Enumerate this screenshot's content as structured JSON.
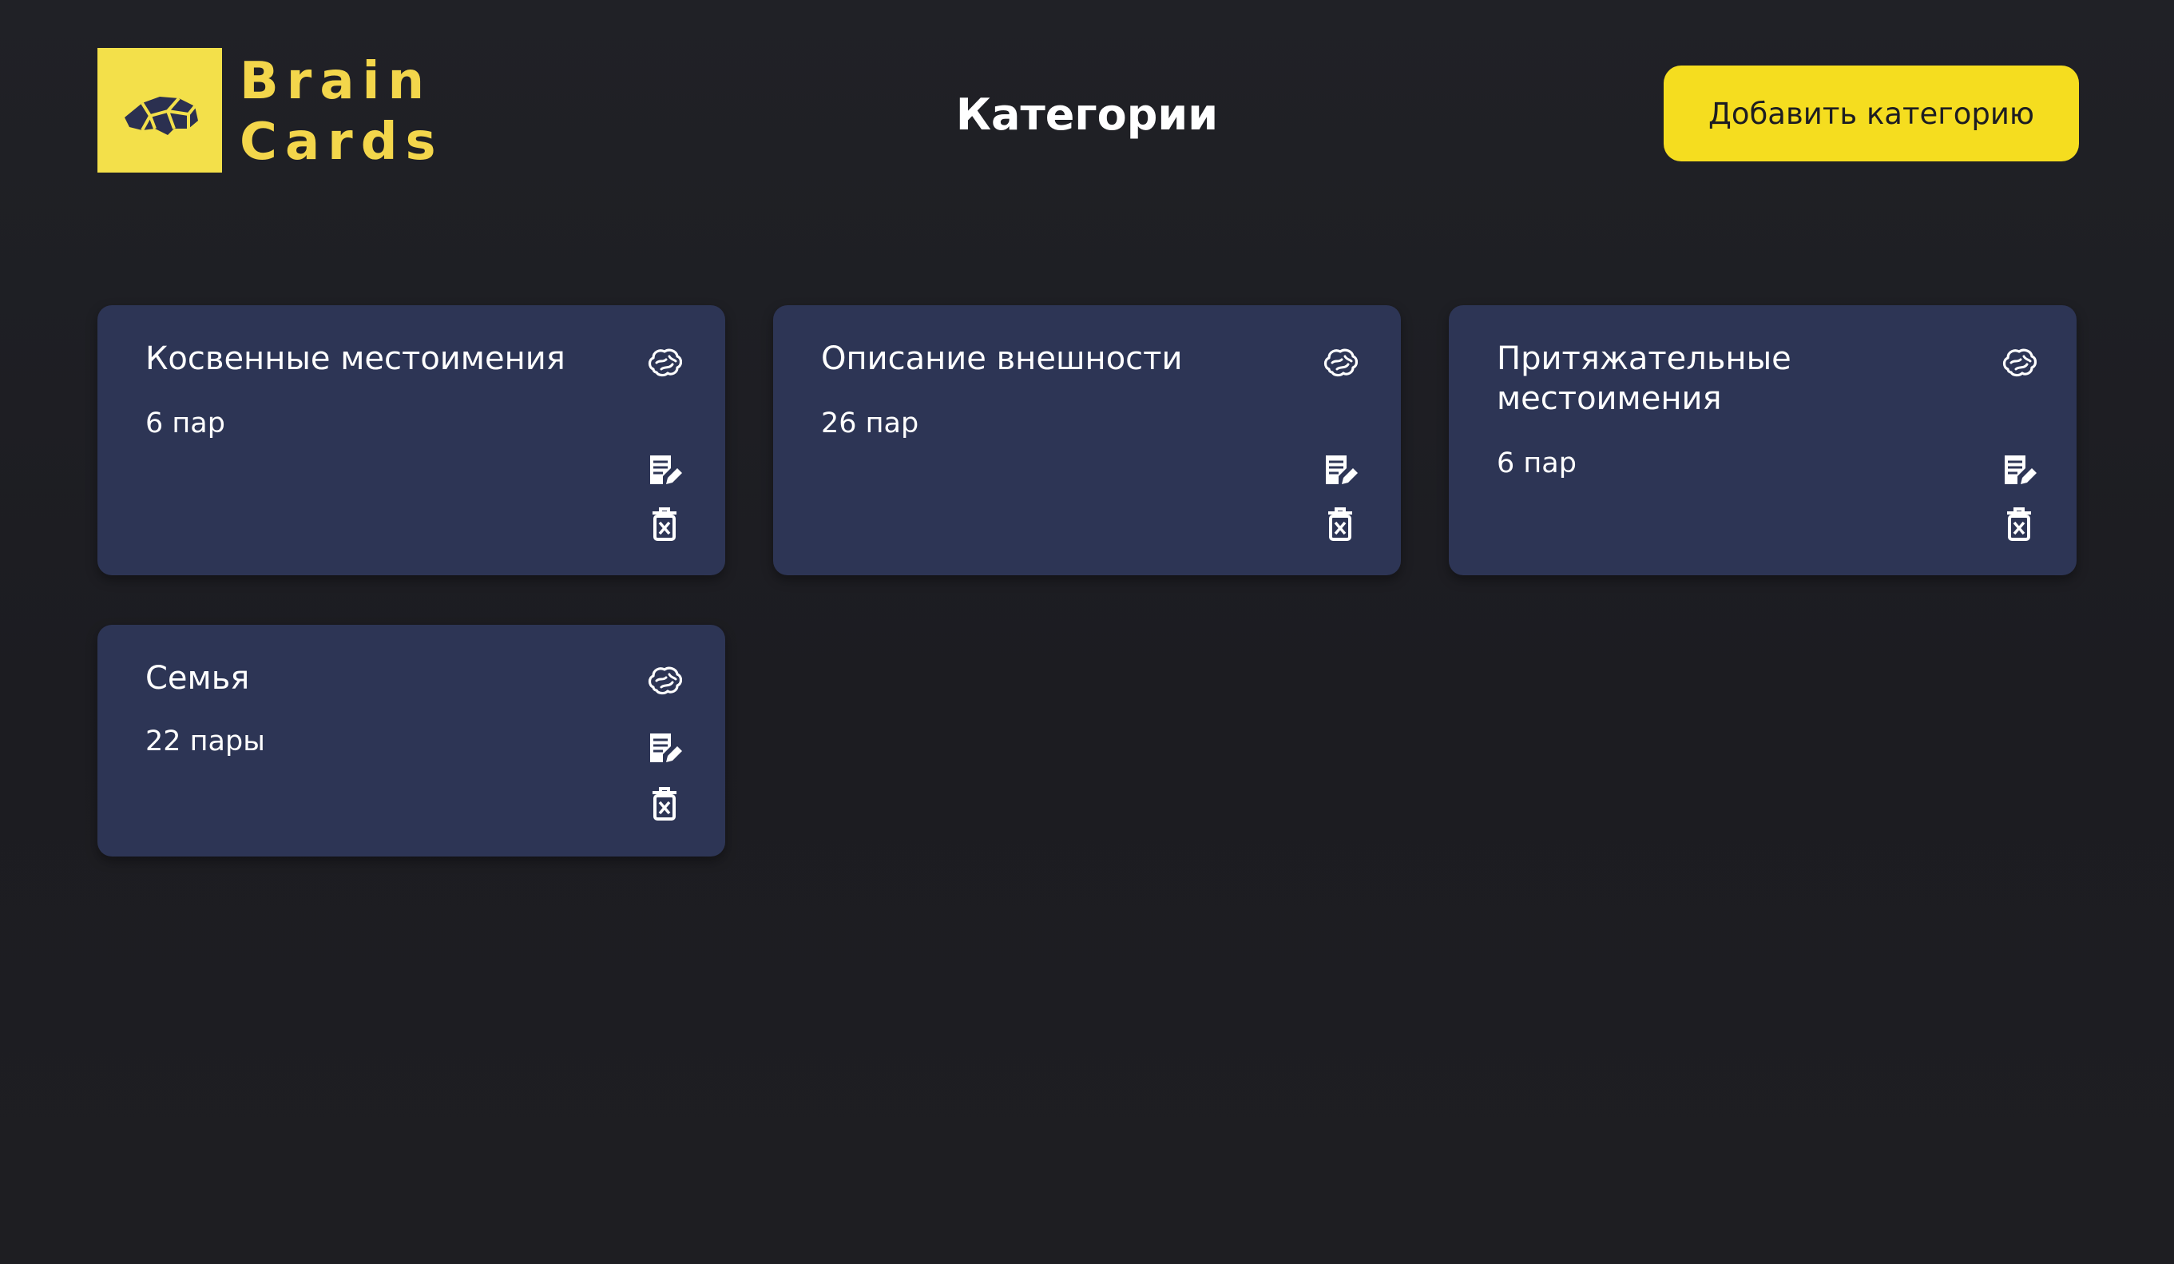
{
  "app": {
    "logo_line1": "Brain",
    "logo_line2": "Cards",
    "logo_icon": "brain-icon",
    "brand_color": "#f3e04a"
  },
  "header": {
    "title": "Категории",
    "add_button_label": "Добавить категорию",
    "add_button_color": "#f5dd1f"
  },
  "colors": {
    "background": "#1e1f24",
    "card_background": "#2d3555",
    "text": "#ffffff"
  },
  "categories": [
    {
      "title": "Косвенные местоимения",
      "count": "6 пар",
      "icons": [
        "brain-icon",
        "edit-icon",
        "trash-icon"
      ]
    },
    {
      "title": "Описание внешности",
      "count": "26 пар",
      "icons": [
        "brain-icon",
        "edit-icon",
        "trash-icon"
      ]
    },
    {
      "title": "Притяжательные местоимения",
      "count": "6 пар",
      "icons": [
        "brain-icon",
        "edit-icon",
        "trash-icon"
      ]
    },
    {
      "title": "Семья",
      "count": "22 пары",
      "icons": [
        "brain-icon",
        "edit-icon",
        "trash-icon"
      ]
    }
  ]
}
